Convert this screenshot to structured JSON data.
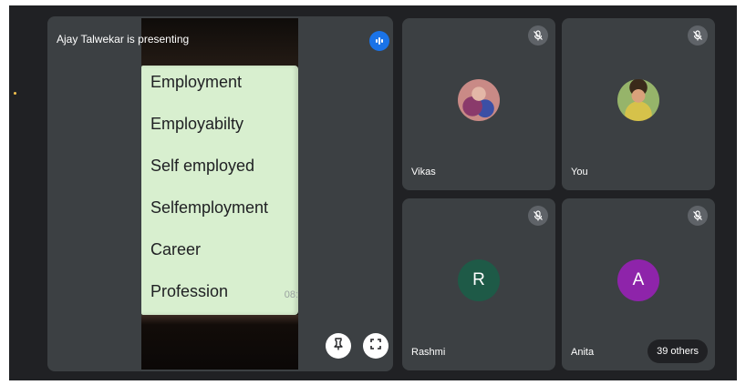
{
  "presentation": {
    "label": "Ajay Talwekar is presenting",
    "slide_items": [
      "Employment",
      "Employabilty",
      "Self employed",
      "Selfemployment",
      "Career",
      "Profession"
    ],
    "slide_page": "08:"
  },
  "participants": [
    {
      "name": "Vikas",
      "avatar": "",
      "avatar_color": "#c98a86",
      "muted": true
    },
    {
      "name": "You",
      "avatar": "",
      "avatar_color": "#96b46a",
      "muted": true
    },
    {
      "name": "Rashmi",
      "avatar": "R",
      "avatar_color": "#1e5a47",
      "muted": true
    },
    {
      "name": "Anita",
      "avatar": "A",
      "avatar_color": "#8e24aa",
      "muted": true
    }
  ],
  "others_chip": "39 others",
  "colors": {
    "background": "#202124",
    "tile": "#3c4043",
    "accent_blue": "#1a73e8",
    "slide_paper": "#d8efcf"
  },
  "icons": {
    "audio_active": "audio-active-icon",
    "mic_off": "mic-off-icon",
    "pin": "pin-icon",
    "fullscreen": "fullscreen-icon"
  }
}
